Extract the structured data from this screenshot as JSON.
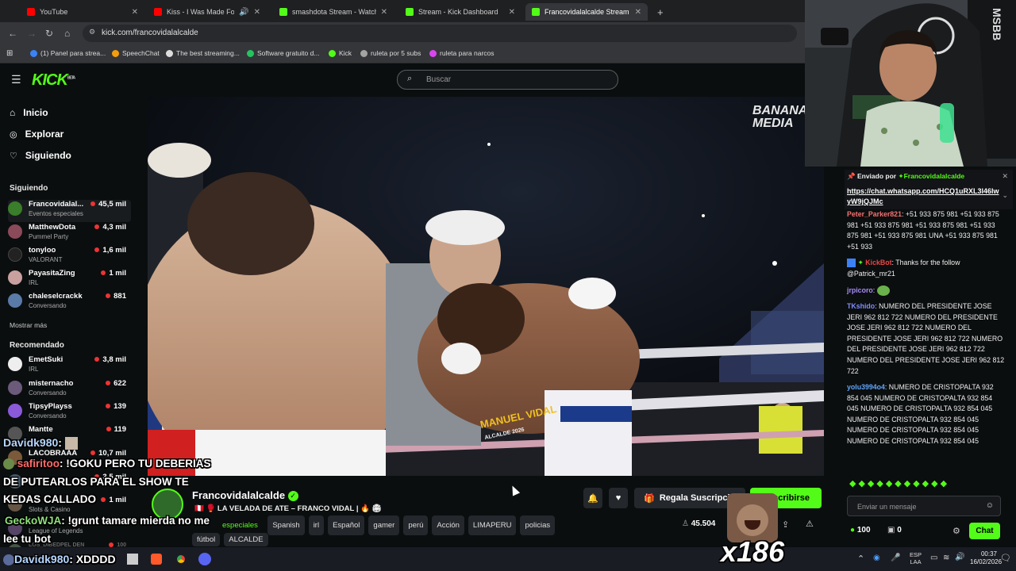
{
  "tabs": [
    {
      "label": "YouTube",
      "color": "#ff0000"
    },
    {
      "label": "Kiss - I Was Made For Lovin",
      "color": "#ff0000"
    },
    {
      "label": "smashdota Stream - Watch Live",
      "color": "#53fc18"
    },
    {
      "label": "Stream - Kick Dashboard",
      "color": "#53fc18"
    },
    {
      "label": "Francovidalalcalde Stream - Wa",
      "color": "#53fc18"
    }
  ],
  "address": {
    "url": "kick.com/francovidalalcalde"
  },
  "bookmarks": [
    {
      "label": "(1) Panel para strea...",
      "color": "#3b82f6"
    },
    {
      "label": "SpeechChat",
      "color": "#f59e0b"
    },
    {
      "label": "The best streaming...",
      "color": "#dddddd"
    },
    {
      "label": "Software gratuito d...",
      "color": "#22c55e"
    },
    {
      "label": "Kick",
      "color": "#53fc18"
    },
    {
      "label": "ruleta por 5 subs",
      "color": "#a3a3a3"
    },
    {
      "label": "ruleta para narcos",
      "color": "#d946ef"
    }
  ],
  "header": {
    "logo": "KICK",
    "logo_sup": "BETA",
    "search_placeholder": "Buscar"
  },
  "sidebar": {
    "nav": [
      {
        "label": "Inicio",
        "icon": "home-icon"
      },
      {
        "label": "Explorar",
        "icon": "compass-icon"
      },
      {
        "label": "Siguiendo",
        "icon": "heart-icon"
      }
    ],
    "following_title": "Siguiendo",
    "following": [
      {
        "name": "Francovidalal...",
        "game": "Eventos especiales",
        "viewers": "45,5 mil",
        "color": "#3a7d2a"
      },
      {
        "name": "MatthewDota",
        "game": "Pummel Party",
        "viewers": "4,3 mil",
        "color": "#8b4a5a"
      },
      {
        "name": "tonyloo",
        "game": "VALORANT",
        "viewers": "1,6 mil",
        "color": "#222222"
      },
      {
        "name": "PayasitaZing",
        "game": "IRL",
        "viewers": "1 mil",
        "color": "#c9a0a0"
      },
      {
        "name": "chaleselcrackk",
        "game": "Conversando",
        "viewers": "881",
        "color": "#5a7aa8"
      }
    ],
    "show_more": "Mostrar más",
    "recommended_title": "Recomendado",
    "recommended": [
      {
        "name": "EmetSuki",
        "game": "IRL",
        "viewers": "3,8 mil",
        "color": "#eeeeee"
      },
      {
        "name": "misternacho",
        "game": "Conversando",
        "viewers": "622",
        "color": "#6b5a7a"
      },
      {
        "name": "TipsyPlayss",
        "game": "Conversando",
        "viewers": "139",
        "color": "#8a5ad9"
      },
      {
        "name": "Mantte",
        "game": "",
        "viewers": "119",
        "color": "#555555"
      },
      {
        "name": "LACOBRAAA",
        "game": "",
        "viewers": "10,7 mil",
        "color": "#7a5a3a"
      },
      {
        "name": "",
        "game": "",
        "viewers": "3,5 mil",
        "color": "#445566"
      },
      {
        "name": "",
        "game": "Slots & Casino",
        "viewers": "1 mil",
        "color": "#665544"
      },
      {
        "name": "",
        "game": "League of Legends",
        "viewers": "",
        "color": "#554466"
      },
      {
        "name": "LOS_DIBEDPEL DEN",
        "game": "",
        "viewers": "100",
        "color": "#445544"
      }
    ]
  },
  "video": {
    "watermark": "BANANA MEDIA",
    "shorts_text": "MANUEL VIDAL",
    "shorts_sub": "ALCALDE 2026"
  },
  "stream": {
    "streamer": "Francovidalalcalde",
    "title": "🇵🇪 🥊 LA VELADA DE ATE – FRANCO VIDAL | 🔥 🏟",
    "category": "especiales",
    "tags": [
      "Spanish",
      "irl",
      "Español",
      "gamer",
      "perú",
      "Acción",
      "LIMAPERU",
      "policias",
      "fútbol",
      "ALCALDE"
    ],
    "viewers": "45.504",
    "gift_label": "Regala Suscripciones",
    "sub_label": "Suscribirse"
  },
  "overlay": {
    "lines": [
      {
        "user": "Davidk980",
        "text": ":"
      },
      {
        "user": "safiritoo",
        "text": ": !GOKU PERO TU DEBERIAS"
      },
      {
        "user": "",
        "text": "DE PUTEARLOS PARA EL SHOW TE"
      },
      {
        "user": "",
        "text": "KEDAS CALLADO"
      },
      {
        "user": "GeckoWJA",
        "text": ": !grunt tamare mierda no me"
      },
      {
        "user": "",
        "text": "lee tu bot"
      },
      {
        "user": "Davidk980",
        "text": ": XDDDD"
      }
    ],
    "combo": "x186"
  },
  "chat": {
    "pinned": {
      "by_label": "Enviado por",
      "by_user": "Francovidalalcalde",
      "link": "https://chat.whatsapp.com/HCQ1uRXL3l46lwyW9jQJMc"
    },
    "messages": [
      {
        "user": "Peter_Parker821",
        "color": "#f87171",
        "text": ": +51 933 875 981 +51 933 875 981 +51 933 875 981 +51 933 875 981 +51 933 875 981 +51 933 875 981 UNA +51 933 875 981 +51 933"
      },
      {
        "user": "KickBot",
        "color": "#ef4444",
        "text": ": Thanks for the follow @Patrick_mr21"
      },
      {
        "user": "jrpicoro",
        "color": "#a78bfa",
        "text": ":"
      },
      {
        "user": "TKshido",
        "color": "#818cf8",
        "text": ": NUMERO DEL PRESIDENTE JOSE JERI 962 812 722 NUMERO DEL PRESIDENTE JOSE JERI 962 812 722 NUMERO DEL PRESIDENTE JOSE JERI 962 812 722 NUMERO DEL PRESIDENTE JOSE JERI 962 812 722 NUMERO DEL PRESIDENTE JOSE JERI 962 812 722"
      },
      {
        "user": "yolu3994o4",
        "color": "#60a5fa",
        "text": ": NUMERO DE CRISTOPALTA 932 854 045 NUMERO DE CRISTOPALTA 932 854 045 NUMERO DE CRISTOPALTA 932 854 045 NUMERO DE CRISTOPALTA 932 854 045 NUMERO DE CRISTOPALTA 932 854 045 NUMERO DE CRISTOPALTA 932 854 045"
      }
    ],
    "input_placeholder": "Enviar un mensaje",
    "points": "100",
    "other_count": "0",
    "send_label": "Chat"
  },
  "taskbar": {
    "lang": "ESP",
    "lang_sub": "LAA",
    "time": "00:37",
    "date": "16/02/2026"
  },
  "colors": {
    "accent": "#53fc18",
    "bg": "#0b0e0f"
  }
}
